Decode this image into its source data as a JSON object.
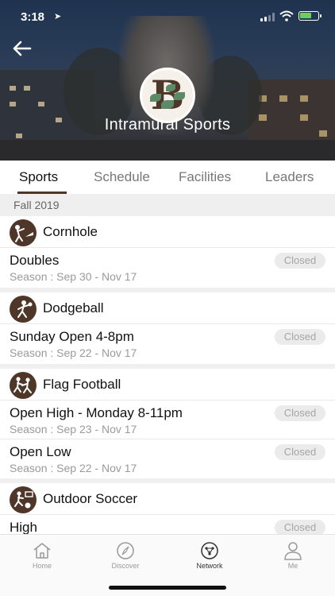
{
  "status_bar": {
    "time": "3:18"
  },
  "header": {
    "title": "Intramural Sports",
    "logo_letter": "B"
  },
  "tabs": [
    {
      "label": "Sports",
      "active": true
    },
    {
      "label": "Schedule",
      "active": false
    },
    {
      "label": "Facilities",
      "active": false
    },
    {
      "label": "Leaders",
      "active": false
    }
  ],
  "season_label": "Fall 2019",
  "sports": [
    {
      "name": "Cornhole",
      "icon": "cornhole-icon",
      "leagues": [
        {
          "name": "Doubles",
          "season": "Season : Sep 30 - Nov 17",
          "status": "Closed"
        }
      ]
    },
    {
      "name": "Dodgeball",
      "icon": "dodgeball-icon",
      "leagues": [
        {
          "name": "Sunday Open 4-8pm",
          "season": "Season : Sep 22 - Nov 17",
          "status": "Closed"
        }
      ]
    },
    {
      "name": "Flag Football",
      "icon": "flag-football-icon",
      "leagues": [
        {
          "name": "Open High - Monday 8-11pm",
          "season": "Season : Sep 23 - Nov 17",
          "status": "Closed"
        },
        {
          "name": "Open Low",
          "season": "Season : Sep 22 - Nov 17",
          "status": "Closed"
        }
      ]
    },
    {
      "name": "Outdoor Soccer",
      "icon": "soccer-icon",
      "leagues": [
        {
          "name": "High",
          "season": "",
          "status": "Closed"
        }
      ]
    }
  ],
  "bottom_nav": [
    {
      "label": "Home",
      "icon": "home-icon",
      "active": false
    },
    {
      "label": "Discover",
      "icon": "compass-icon",
      "active": false
    },
    {
      "label": "Network",
      "icon": "network-icon",
      "active": true
    },
    {
      "label": "Me",
      "icon": "person-icon",
      "active": false
    }
  ],
  "colors": {
    "brand_brown": "#4e3629",
    "closed_pill_bg": "#ebebeb",
    "closed_pill_text": "#a5a5a5"
  }
}
